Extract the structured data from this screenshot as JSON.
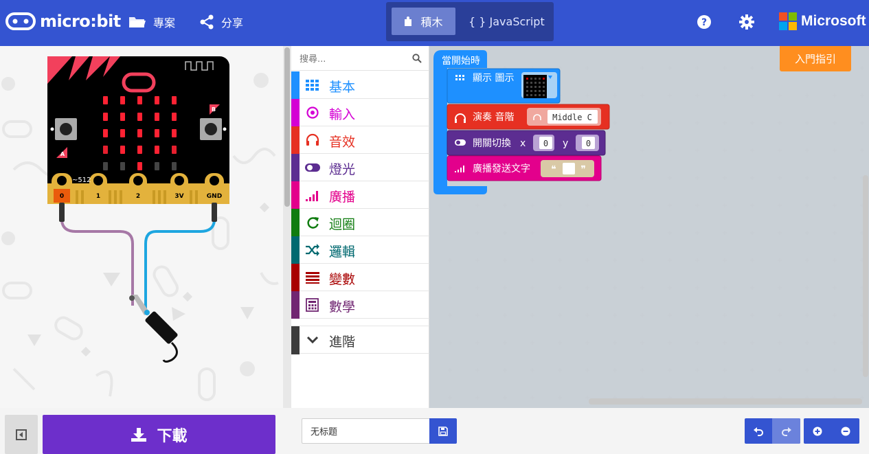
{
  "header": {
    "logo_text": "micro:bit",
    "projects_label": "專案",
    "share_label": "分享",
    "mode_blocks_label": "積木",
    "mode_js_label": "{ } JavaScript",
    "microsoft_label": "Microsoft",
    "brand_color": "#3454d1"
  },
  "simulator": {
    "pin_labels": [
      "0",
      "1",
      "2",
      "3V",
      "GND"
    ],
    "button_a_label": "A",
    "button_b_label": "B",
    "readout": "~512"
  },
  "toolbox": {
    "search_placeholder": "搜尋...",
    "categories": [
      {
        "label": "基本",
        "color": "#1e90ff",
        "icon": "grid-icon"
      },
      {
        "label": "輸入",
        "color": "#d400d4",
        "icon": "target-icon"
      },
      {
        "label": "音效",
        "color": "#e63022",
        "icon": "headphones-icon"
      },
      {
        "label": "燈光",
        "color": "#5c2d91",
        "icon": "toggle-icon"
      },
      {
        "label": "廣播",
        "color": "#e3008c",
        "icon": "signal-icon"
      },
      {
        "label": "迴圈",
        "color": "#107c10",
        "icon": "loop-icon"
      },
      {
        "label": "邏輯",
        "color": "#006970",
        "icon": "shuffle-icon"
      },
      {
        "label": "變數",
        "color": "#a80000",
        "icon": "lines-icon"
      },
      {
        "label": "數學",
        "color": "#712672",
        "icon": "calculator-icon"
      }
    ],
    "advanced_label": "進階",
    "advanced_color": "#3c3c3c"
  },
  "workspace": {
    "tutorial_label": "入門指引",
    "blocks": {
      "on_start": "當開始時",
      "show_icon": "顯示 圖示",
      "play_tone": "演奏 音階",
      "tone_value": "Middle C",
      "toggle": "開關切換",
      "x_label": "x",
      "x_value": "0",
      "y_label": "y",
      "y_value": "0",
      "radio_send": "廣播發送文字",
      "string_open": "❝",
      "string_close": "❞"
    }
  },
  "footer": {
    "download_label": "下載",
    "project_name": "无标题"
  }
}
